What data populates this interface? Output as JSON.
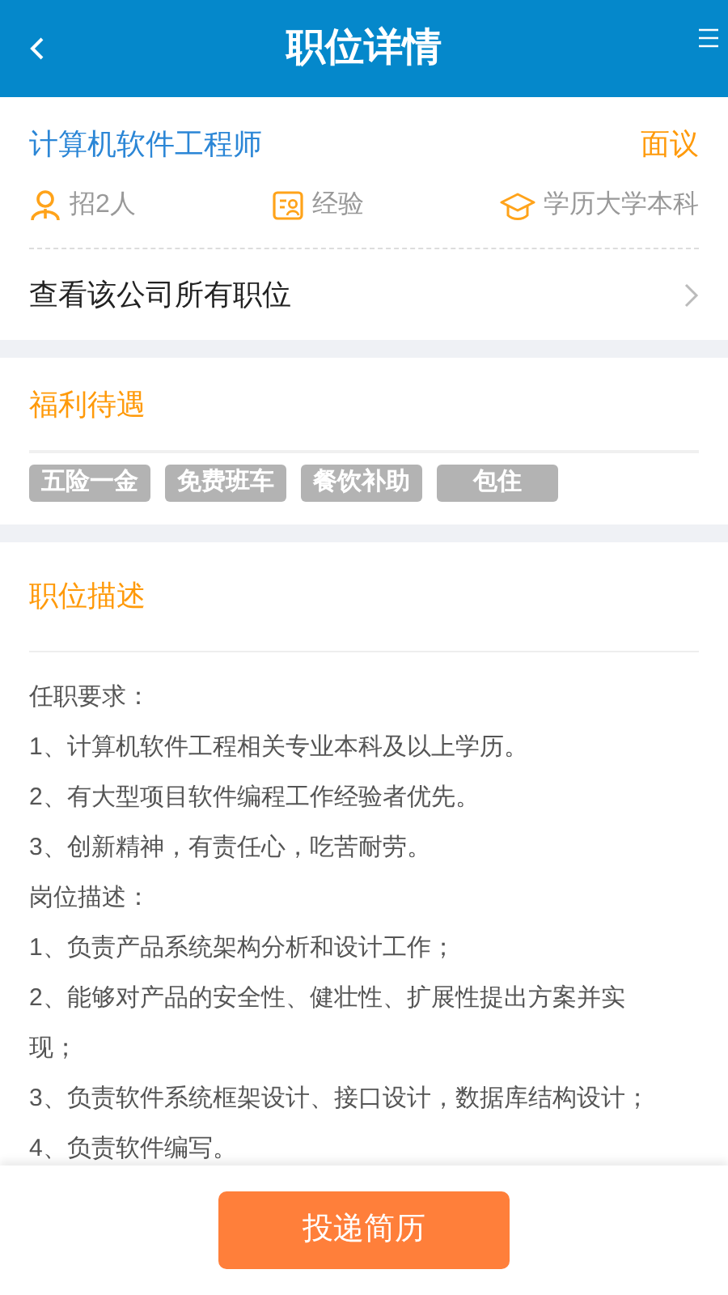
{
  "header": {
    "title": "职位详情"
  },
  "job": {
    "title": "计算机软件工程师",
    "salary": "面议",
    "meta": [
      {
        "kind": "headcount",
        "text": "招2人"
      },
      {
        "kind": "experience",
        "text": "经验"
      },
      {
        "kind": "education",
        "text": "学历大学本科"
      }
    ],
    "company_link": "查看该公司所有职位"
  },
  "benefits": {
    "heading": "福利待遇",
    "tags": [
      "五险一金",
      "免费班车",
      "餐饮补助",
      "包住"
    ]
  },
  "description": {
    "heading": "职位描述",
    "lines": [
      "任职要求：",
      "1、计算机软件工程相关专业本科及以上学历。",
      "2、有大型项目软件编程工作经验者优先。",
      "3、创新精神，有责任心，吃苦耐劳。",
      "岗位描述：",
      "1、负责产品系统架构分析和设计工作；",
      "2、能够对产品的安全性、健壮性、扩展性提出方案并实现；",
      "3、负责软件系统框架设计、接口设计，数据库结构设计；",
      "4、负责软件编写。"
    ]
  },
  "apply_button": "投递简历"
}
